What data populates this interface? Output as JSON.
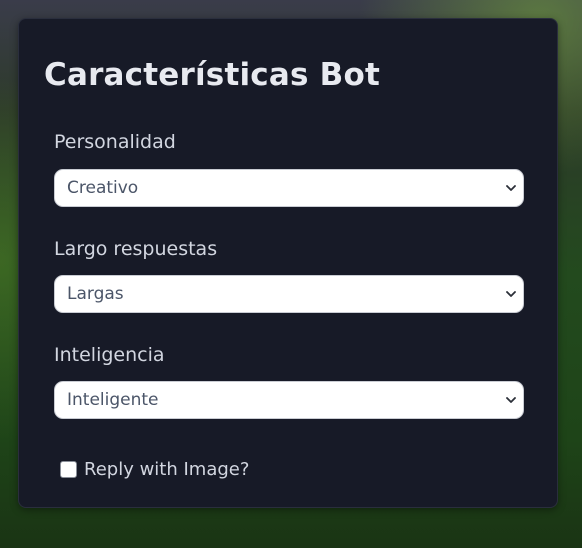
{
  "panel": {
    "title": "Características Bot"
  },
  "fields": [
    {
      "label": "Personalidad",
      "selected": "Creativo"
    },
    {
      "label": "Largo respuestas",
      "selected": "Largas"
    },
    {
      "label": "Inteligencia",
      "selected": "Inteligente"
    }
  ],
  "reply_image": {
    "label": "Reply with Image?",
    "checked": false
  },
  "icons": {
    "select_arrow": "chevron-down-icon"
  }
}
